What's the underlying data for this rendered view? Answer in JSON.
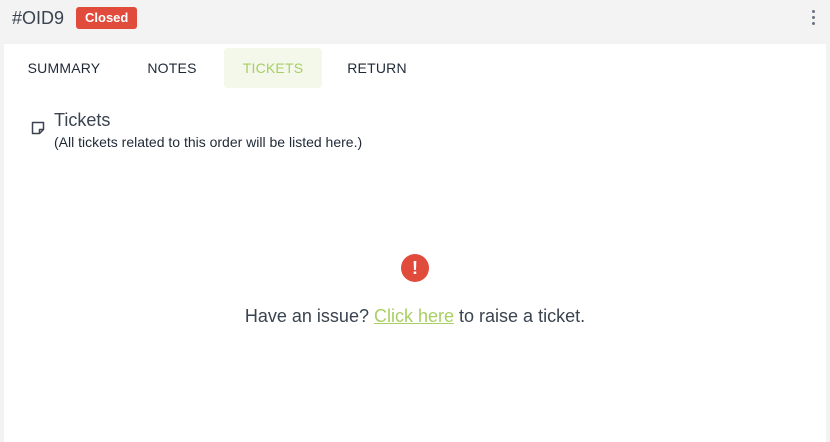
{
  "header": {
    "order_id": "#OID9",
    "status": "Closed",
    "menu_icon": "kebab-menu-icon"
  },
  "tabs": [
    {
      "label": "SUMMARY"
    },
    {
      "label": "NOTES"
    },
    {
      "label": "TICKETS",
      "active": true
    },
    {
      "label": "RETURN"
    }
  ],
  "tickets_section": {
    "icon": "note-icon",
    "title": "Tickets",
    "subtitle": "(All tickets related to this order will be listed here.)"
  },
  "empty_state": {
    "icon": "alert-icon",
    "prefix": "Have an issue?",
    "link_text": "Click here",
    "suffix": "to raise a ticket."
  },
  "colors": {
    "status_badge": "#e04b3c",
    "accent_green": "#a8cf63",
    "active_tab_bg": "#f3f8ea"
  }
}
